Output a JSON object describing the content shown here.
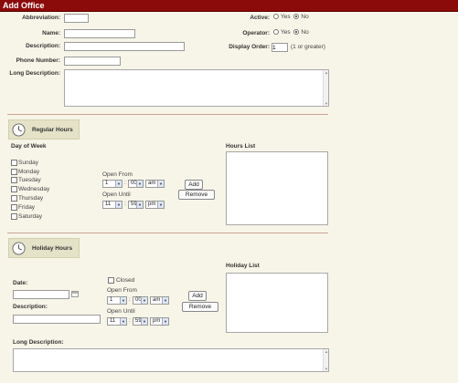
{
  "title": "Add Office",
  "form": {
    "abbreviation_label": "Abbreviation:",
    "name_label": "Name:",
    "description_label": "Description:",
    "phone_label": "Phone Number:",
    "long_description_label": "Long Description:",
    "active_label": "Active:",
    "operator_label": "Operator:",
    "display_order_label": "Display Order:",
    "display_order_value": "1",
    "display_order_hint": "(1 or greater)",
    "yes_label": "Yes",
    "no_label": "No",
    "active_selected": "No",
    "operator_selected": "No"
  },
  "regular_hours": {
    "header": "Regular Hours",
    "day_of_week_label": "Day of Week",
    "days": [
      "Sunday",
      "Monday",
      "Tuesday",
      "Wednesday",
      "Thursday",
      "Friday",
      "Saturday"
    ],
    "open_from_label": "Open From",
    "open_until_label": "Open Until",
    "from_hour": "1",
    "from_minute": "00",
    "from_ampm": "am",
    "until_hour": "11",
    "until_minute": "59",
    "until_ampm": "pm",
    "colon": ":",
    "add_button": "Add",
    "remove_button": "Remove",
    "hours_list_label": "Hours List"
  },
  "holiday_hours": {
    "header": "Holiday Hours",
    "date_label": "Date:",
    "description_label": "Description:",
    "closed_label": "Closed",
    "open_from_label": "Open From",
    "open_until_label": "Open Until",
    "from_hour": "1",
    "from_minute": "00",
    "from_ampm": "am",
    "until_hour": "11",
    "until_minute": "59",
    "until_ampm": "pm",
    "colon": ":",
    "add_button": "Add",
    "remove_button": "Remove",
    "holiday_list_label": "Holiday List",
    "long_description_label": "Long Description:"
  },
  "icons": {
    "clock": "clock-icon",
    "calendar": "calendar-icon",
    "dropdown_arrow": "chevron-down-icon",
    "scroll_up": "▲",
    "scroll_down": "▼",
    "arrow": "▼"
  },
  "colors": {
    "title_bar": "#8b0a0a",
    "background": "#f7f5e8",
    "separator": "#c9a595",
    "section_header_bg": "#e4e2c7"
  }
}
